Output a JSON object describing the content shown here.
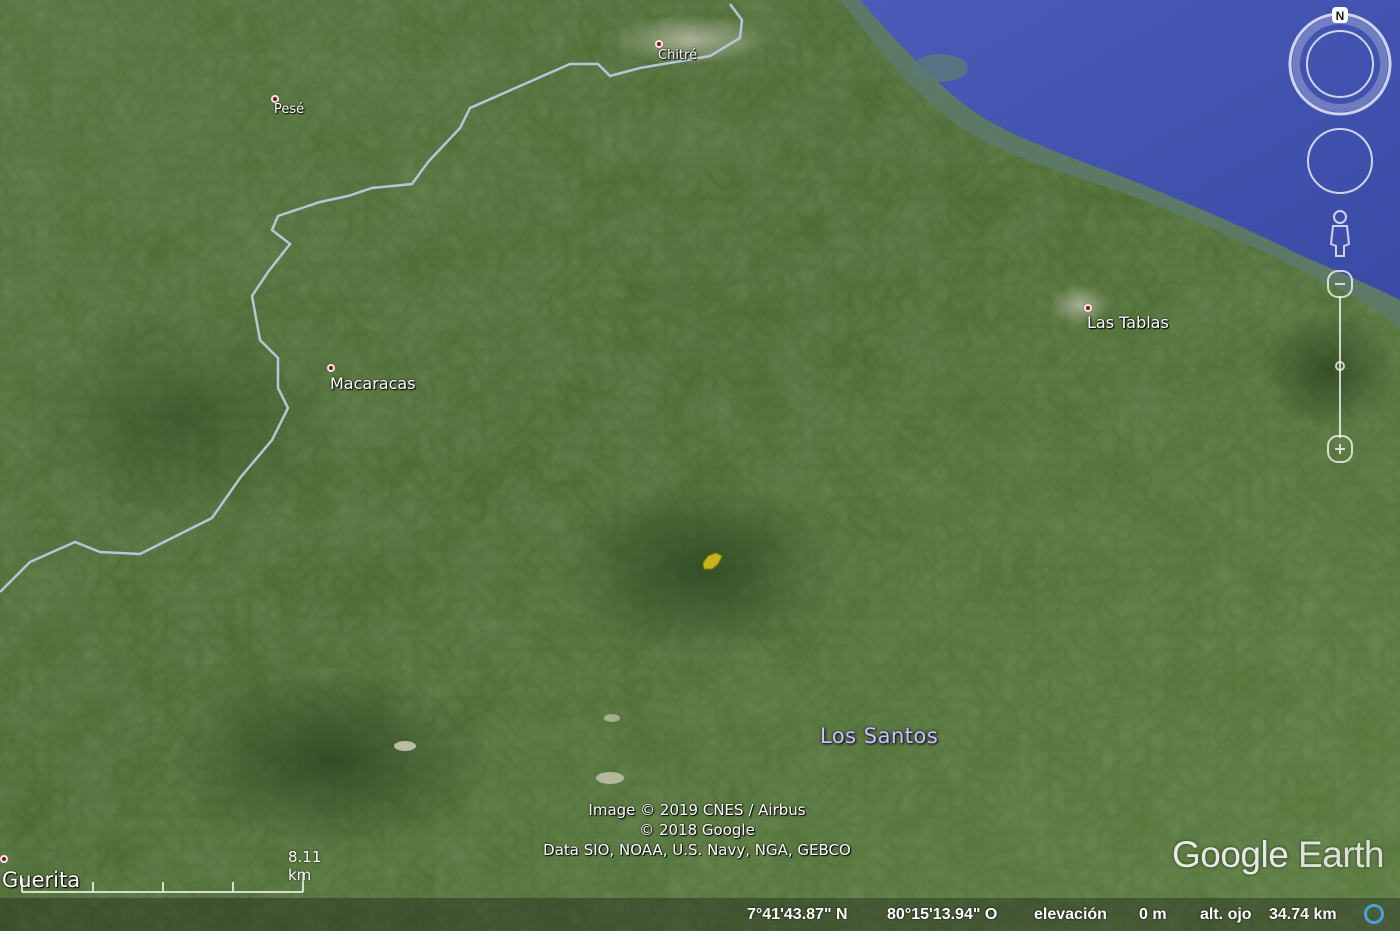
{
  "places": [
    {
      "name": "Chitré",
      "font_size": 13
    },
    {
      "name": "Pesé",
      "font_size": 13
    },
    {
      "name": "Macaracas",
      "font_size": 16
    },
    {
      "name": "Las Tablas",
      "font_size": 16
    },
    {
      "name": "Guerita",
      "font_size": 21
    }
  ],
  "region": {
    "name": "Los Santos"
  },
  "attribution": {
    "line1": "Image © 2019 CNES / Airbus",
    "line2": "© 2018 Google",
    "line3": "Data SIO, NOAA, U.S. Navy, NGA, GEBCO"
  },
  "brand": {
    "part1": "Google",
    "part2": " Earth"
  },
  "scale": {
    "label": "8.11 km"
  },
  "compass": {
    "north_label": "N"
  },
  "status": {
    "latitude": "7°41'43.87\" N",
    "longitude": "80°15'13.94\" O",
    "elevation_label": "elevación",
    "elevation_value": "0 m",
    "eye_alt_label": "alt. ojo",
    "eye_alt_value": "34.74 km"
  },
  "colors": {
    "land": "#4a6a34",
    "sea": "#3c4fa8",
    "road": "#b9c3da",
    "marker": "#c7b31c",
    "place_dot": "#8b0f12"
  }
}
